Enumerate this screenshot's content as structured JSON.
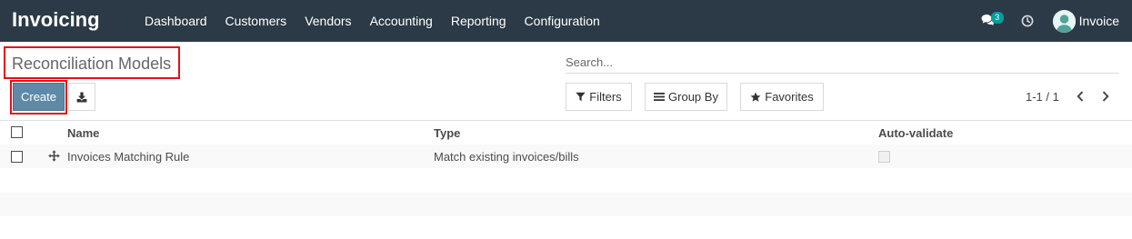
{
  "app": {
    "title": "Invoicing"
  },
  "menu": {
    "items": [
      {
        "label": "Dashboard"
      },
      {
        "label": "Customers"
      },
      {
        "label": "Vendors"
      },
      {
        "label": "Accounting"
      },
      {
        "label": "Reporting"
      },
      {
        "label": "Configuration"
      }
    ]
  },
  "systray": {
    "messages_count": "3",
    "user_name": "Invoice",
    "icons": [
      "chat-icon",
      "clock-icon",
      "avatar"
    ]
  },
  "control_panel": {
    "breadcrumb": "Reconciliation Models",
    "search_placeholder": "Search...",
    "create_label": "Create",
    "download_icon": "download-icon",
    "filters_label": "Filters",
    "groupby_label": "Group By",
    "favorites_label": "Favorites",
    "pager": "1-1 / 1"
  },
  "table": {
    "columns": [
      {
        "label": "Name"
      },
      {
        "label": "Type"
      },
      {
        "label": "Auto-validate"
      }
    ],
    "rows": [
      {
        "name": "Invoices Matching Rule",
        "type": "Match existing invoices/bills",
        "auto_validate": false
      }
    ]
  },
  "colors": {
    "navbar": "#2c3a47",
    "primary_button": "#5e8aa8",
    "highlight_border": "#e5101b",
    "badge": "#00a09d"
  }
}
